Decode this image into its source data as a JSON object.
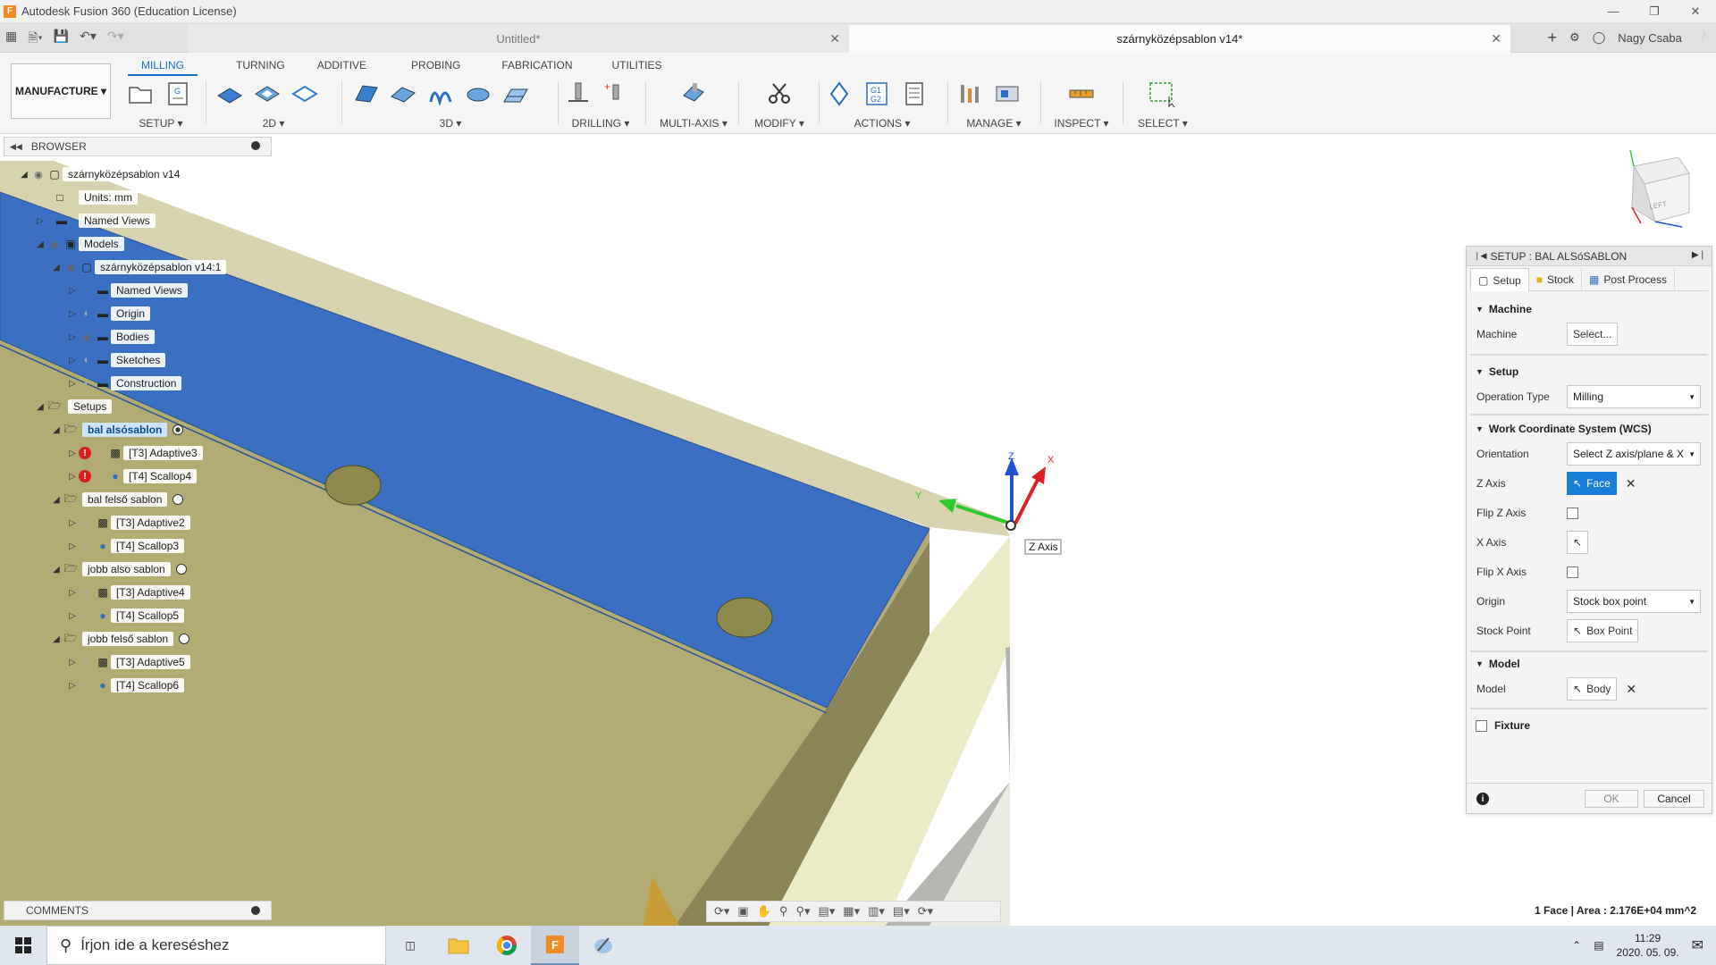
{
  "window": {
    "title": "Autodesk Fusion 360 (Education License)",
    "app_icon": "F"
  },
  "tabs": [
    {
      "label": "Untitled*"
    },
    {
      "label": "szárnyközépsablon v14*"
    }
  ],
  "user": {
    "name": "Nagy Csaba"
  },
  "toolbar": {
    "workspace": "MANUFACTURE",
    "ribbon_tabs": [
      "MILLING",
      "TURNING",
      "ADDITIVE",
      "PROBING",
      "FABRICATION",
      "UTILITIES"
    ],
    "groups": {
      "setup": "SETUP",
      "twod": "2D",
      "threed": "3D",
      "drilling": "DRILLING",
      "multiaxis": "MULTI-AXIS",
      "modify": "MODIFY",
      "actions": "ACTIONS",
      "manage": "MANAGE",
      "inspect": "INSPECT",
      "select": "SELECT"
    }
  },
  "browser": {
    "title": "BROWSER",
    "root": "szárnyközépsablon v14",
    "units": "Units: mm",
    "named_views": "Named Views",
    "models": "Models",
    "model_instance": "szárnyközépsablon v14:1",
    "model_children": [
      "Named Views",
      "Origin",
      "Bodies",
      "Sketches",
      "Construction"
    ],
    "setups_label": "Setups",
    "setups": [
      {
        "name": "bal alsósablon",
        "ops": [
          "[T3] Adaptive3",
          "[T4] Scallop4"
        ]
      },
      {
        "name": "bal felső sablon",
        "ops": [
          "[T3] Adaptive2",
          "[T4] Scallop3"
        ]
      },
      {
        "name": "jobb also sablon",
        "ops": [
          "[T3] Adaptive4",
          "[T4] Scallop5"
        ]
      },
      {
        "name": "jobb felső sablon",
        "ops": [
          "[T3] Adaptive5",
          "[T4] Scallop6"
        ]
      }
    ]
  },
  "viewport": {
    "axis_labels": {
      "x": "X",
      "y": "Y",
      "z": "Z"
    },
    "tooltip": "Z Axis",
    "viewcube_face": "LEFT"
  },
  "dialog": {
    "title": "SETUP : BAL ALSóSABLON",
    "tabs": [
      "Setup",
      "Stock",
      "Post Process"
    ],
    "sections": {
      "machine": "Machine",
      "setup": "Setup",
      "wcs": "Work Coordinate System (WCS)",
      "model": "Model",
      "fixture": "Fixture"
    },
    "fields": {
      "machine_label": "Machine",
      "machine_value": "Select...",
      "operation_type_label": "Operation Type",
      "operation_type_value": "Milling",
      "orientation_label": "Orientation",
      "orientation_value": "Select Z axis/plane & X axis",
      "z_axis_label": "Z Axis",
      "z_axis_value": "Face",
      "flip_z_label": "Flip Z Axis",
      "x_axis_label": "X Axis",
      "flip_x_label": "Flip X Axis",
      "origin_label": "Origin",
      "origin_value": "Stock box point",
      "stock_point_label": "Stock Point",
      "stock_point_value": "Box Point",
      "model_label": "Model",
      "model_value": "Body"
    },
    "ok": "OK",
    "cancel": "Cancel"
  },
  "comments": {
    "title": "COMMENTS"
  },
  "status": {
    "text": "1 Face | Area : 2.176E+04 mm^2"
  },
  "taskbar": {
    "search_placeholder": "Írjon ide a kereséshez",
    "time": "11:29",
    "date": "2020. 05. 09."
  },
  "colors": {
    "face_blue": "#3a6fc1",
    "stock_khaki": "#b8b07e",
    "accent": "#1473c7"
  }
}
